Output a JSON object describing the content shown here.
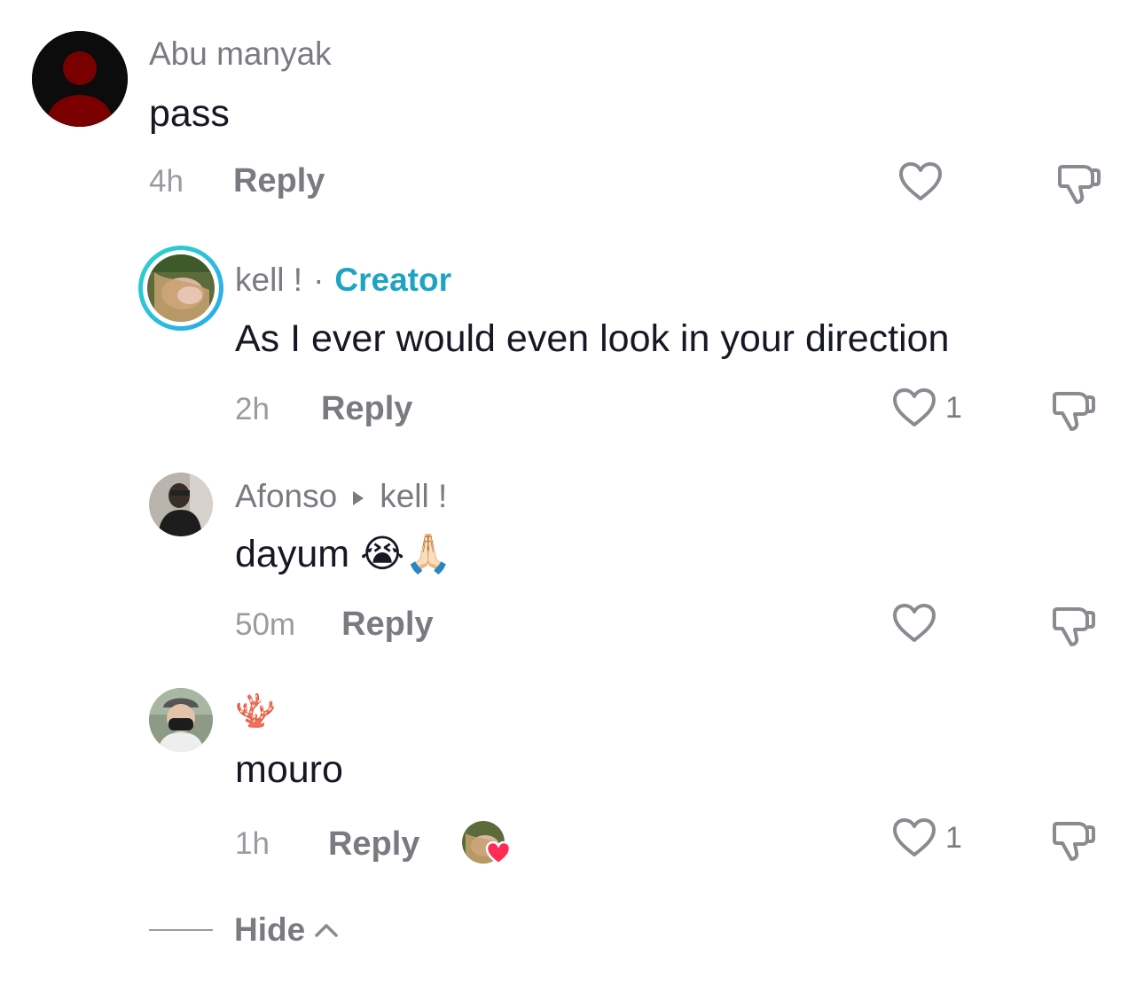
{
  "comments": [
    {
      "username": "Abu manyak",
      "text": "pass",
      "time": "4h",
      "reply_label": "Reply",
      "likes": "",
      "avatar_icon": "default-user-icon"
    },
    {
      "username": "kell !",
      "separator": "·",
      "badge": "Creator",
      "text": "As I ever would even look in your direction",
      "time": "2h",
      "reply_label": "Reply",
      "likes": "1",
      "avatar_icon": "user-photo-avatar"
    },
    {
      "username": "Afonso",
      "reply_to": "kell !",
      "text": "dayum 😭🙏🏻",
      "time": "50m",
      "reply_label": "Reply",
      "likes": "",
      "avatar_icon": "user-photo-avatar"
    },
    {
      "username": "🪸",
      "text": "mouro",
      "time": "1h",
      "reply_label": "Reply",
      "likes": "1",
      "avatar_icon": "user-photo-avatar",
      "creator_liked": true
    }
  ],
  "hide_label": "Hide",
  "colors": {
    "creator_accent": "#1fa3c4",
    "avatar_ring_start": "#2dd4c8",
    "avatar_ring_end": "#2aa8f0",
    "heart_red": "#fe2c55"
  }
}
